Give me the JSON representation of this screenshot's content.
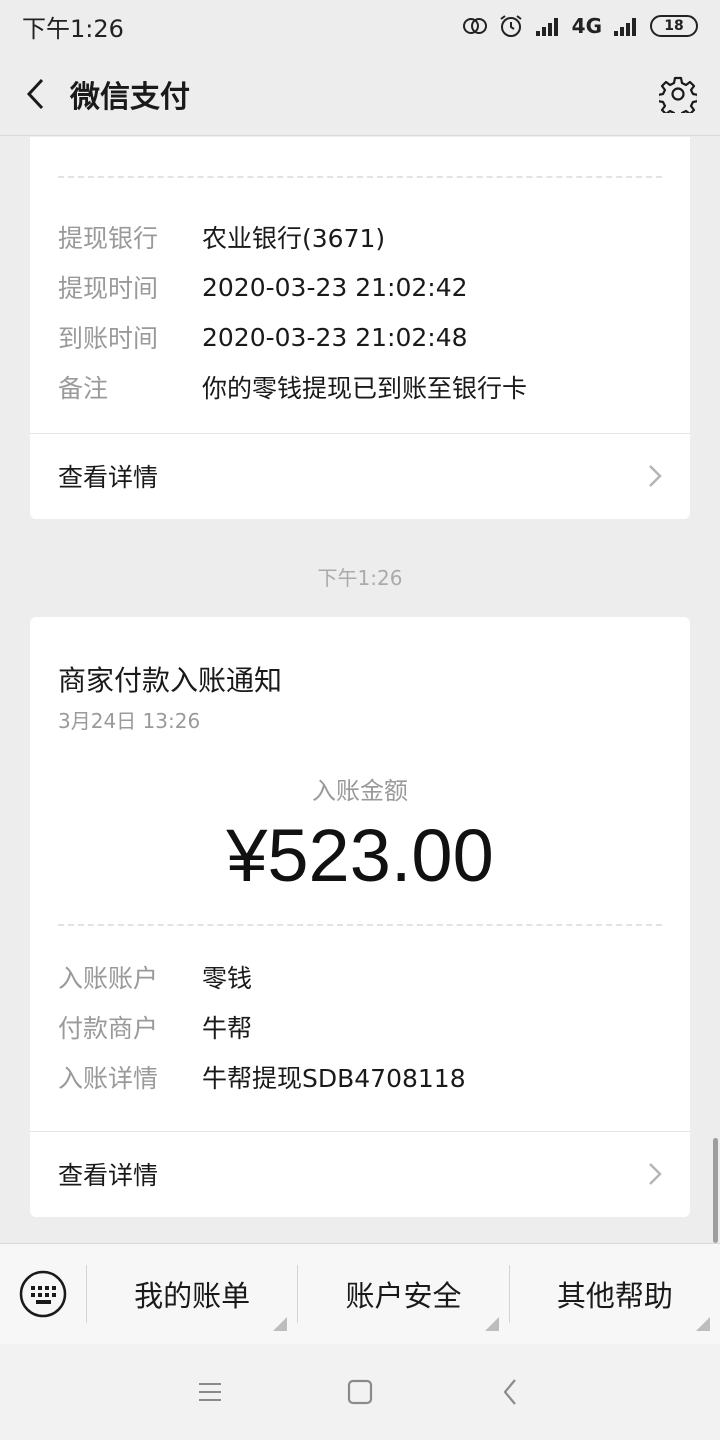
{
  "status_bar": {
    "time": "下午1:26",
    "network": "4G",
    "battery": "18"
  },
  "nav": {
    "title": "微信支付"
  },
  "card1": {
    "rows": [
      {
        "label": "提现银行",
        "value": "农业银行(3671)"
      },
      {
        "label": "提现时间",
        "value": "2020-03-23 21:02:42"
      },
      {
        "label": "到账时间",
        "value": "2020-03-23 21:02:48"
      },
      {
        "label": "备注",
        "value": "你的零钱提现已到账至银行卡"
      }
    ],
    "detail_label": "查看详情"
  },
  "timestamp": "下午1:26",
  "card2": {
    "title": "商家付款入账通知",
    "date": "3月24日  13:26",
    "amount_label": "入账金额",
    "amount": "¥523.00",
    "rows": [
      {
        "label": "入账账户",
        "value": "零钱"
      },
      {
        "label": "付款商户",
        "value": "牛帮"
      },
      {
        "label": "入账详情",
        "value": "牛帮提现SDB4708118"
      }
    ],
    "detail_label": "查看详情"
  },
  "menu": {
    "items": [
      "我的账单",
      "账户安全",
      "其他帮助"
    ]
  },
  "icons": {
    "back": "chevron-left-icon",
    "settings": "gear-icon",
    "keyboard": "keyboard-icon",
    "chevron": "chevron-right-icon"
  }
}
